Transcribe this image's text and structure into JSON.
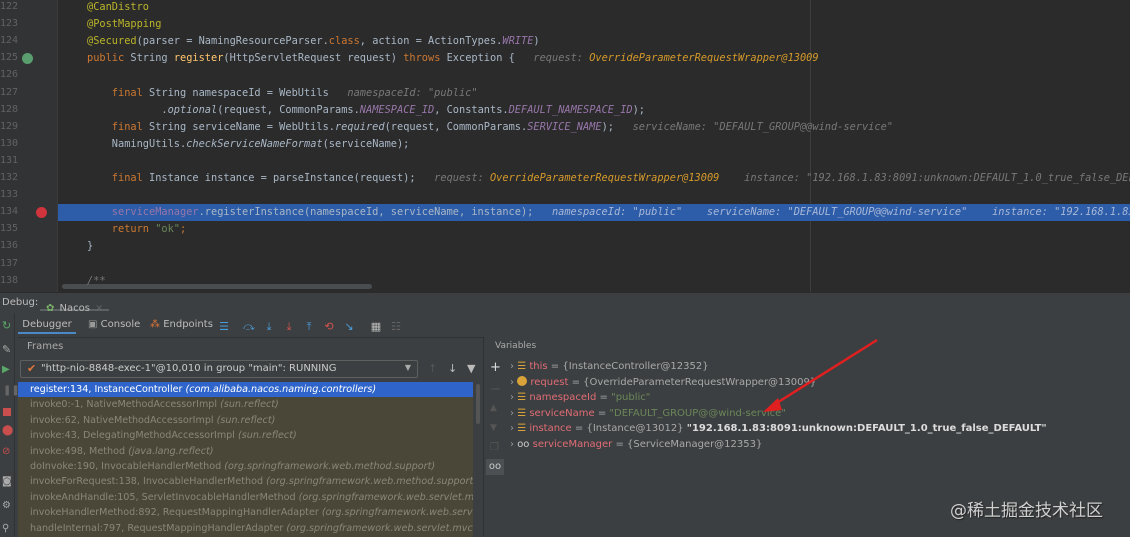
{
  "editor": {
    "line_numbers": [
      "122",
      "123",
      "124",
      "125",
      "126",
      "127",
      "128",
      "129",
      "130",
      "131",
      "132",
      "133",
      "134",
      "135",
      "136",
      "137",
      "138"
    ],
    "lines": [
      [
        {
          "t": "@CanDistro",
          "c": "ann"
        }
      ],
      [
        {
          "t": "@PostMapping",
          "c": "ann"
        }
      ],
      [
        {
          "t": "@Secured",
          "c": "ann"
        },
        {
          "t": "(parser = NamingResourceParser.",
          "c": "plain"
        },
        {
          "t": "class",
          "c": "kw"
        },
        {
          "t": ", action = ActionTypes.",
          "c": "plain"
        },
        {
          "t": "WRITE",
          "c": "const"
        },
        {
          "t": ")",
          "c": "plain"
        }
      ],
      [
        {
          "t": "public ",
          "c": "kw"
        },
        {
          "t": "String ",
          "c": "plain"
        },
        {
          "t": "register",
          "c": "fn"
        },
        {
          "t": "(HttpServletRequest request) ",
          "c": "plain"
        },
        {
          "t": "throws ",
          "c": "kw"
        },
        {
          "t": "Exception {   ",
          "c": "plain"
        },
        {
          "t": "request: ",
          "c": "hint"
        },
        {
          "t": "OverrideParameterRequestWrapper@13009",
          "c": "hintv"
        }
      ],
      [],
      [
        {
          "t": "    final ",
          "c": "kw"
        },
        {
          "t": "String namespaceId = WebUtils   ",
          "c": "plain"
        },
        {
          "t": "namespaceId: \"public\"",
          "c": "hint"
        }
      ],
      [
        {
          "t": "            .",
          "c": "plain"
        },
        {
          "t": "optional",
          "c": "it"
        },
        {
          "t": "(request, CommonParams.",
          "c": "plain"
        },
        {
          "t": "NAMESPACE_ID",
          "c": "const"
        },
        {
          "t": ", Constants.",
          "c": "plain"
        },
        {
          "t": "DEFAULT_NAMESPACE_ID",
          "c": "const"
        },
        {
          "t": ");",
          "c": "plain"
        }
      ],
      [
        {
          "t": "    final ",
          "c": "kw"
        },
        {
          "t": "String serviceName = WebUtils.",
          "c": "plain"
        },
        {
          "t": "required",
          "c": "it"
        },
        {
          "t": "(request, CommonParams.",
          "c": "plain"
        },
        {
          "t": "SERVICE_NAME",
          "c": "const"
        },
        {
          "t": ");   ",
          "c": "plain"
        },
        {
          "t": "serviceName: \"DEFAULT_GROUP@@wind-service\"",
          "c": "hint"
        }
      ],
      [
        {
          "t": "    NamingUtils.",
          "c": "plain"
        },
        {
          "t": "checkServiceNameFormat",
          "c": "it"
        },
        {
          "t": "(serviceName);",
          "c": "plain"
        }
      ],
      [],
      [
        {
          "t": "    final ",
          "c": "kw"
        },
        {
          "t": "Instance instance = parseInstance(request);   ",
          "c": "plain"
        },
        {
          "t": "request: ",
          "c": "hint"
        },
        {
          "t": "OverrideParameterRequestWrapper@13009",
          "c": "hintv"
        },
        {
          "t": "    instance: \"192.168.1.83:8091:unknown:DEFAULT_1.0_true_false_DEFAULT\"",
          "c": "hint"
        }
      ],
      [],
      [
        {
          "t": "    serviceManager",
          "c": "field"
        },
        {
          "t": ".registerInstance(namespaceId, serviceName, instance);   ",
          "c": "plain"
        },
        {
          "t": "namespaceId: \"public\"    serviceName: \"DEFAULT_GROUP@@wind-service\"    instance: \"192.168.1.83:8091:unknown:DEFAULT_1.0_true_false_DEFAULT\"",
          "c": "hint"
        }
      ],
      [
        {
          "t": "    return ",
          "c": "kw"
        },
        {
          "t": "\"ok\"",
          "c": "str"
        },
        {
          "t": ";",
          "c": "kw"
        }
      ],
      [
        {
          "t": "}",
          "c": "plain"
        }
      ],
      [],
      [
        {
          "t": "/**",
          "c": "hint"
        }
      ]
    ],
    "current_line": "134"
  },
  "debug": {
    "label": "Debug:",
    "session_tab": "Nacos",
    "tabs": [
      "Debugger",
      "Console",
      "Endpoints"
    ],
    "frames_title": "Frames",
    "thread": "\"http-nio-8848-exec-1\"@10,010 in group \"main\": RUNNING",
    "frames": [
      {
        "m": "register:134, InstanceController",
        "p": "(com.alibaba.nacos.naming.controllers)"
      },
      {
        "m": "invoke0:-1, NativeMethodAccessorImpl",
        "p": "(sun.reflect)"
      },
      {
        "m": "invoke:62, NativeMethodAccessorImpl",
        "p": "(sun.reflect)"
      },
      {
        "m": "invoke:43, DelegatingMethodAccessorImpl",
        "p": "(sun.reflect)"
      },
      {
        "m": "invoke:498, Method",
        "p": "(java.lang.reflect)"
      },
      {
        "m": "doInvoke:190, InvocableHandlerMethod",
        "p": "(org.springframework.web.method.support)"
      },
      {
        "m": "invokeForRequest:138, InvocableHandlerMethod",
        "p": "(org.springframework.web.method.support)"
      },
      {
        "m": "invokeAndHandle:105, ServletInvocableHandlerMethod",
        "p": "(org.springframework.web.servlet.mvc.method.annotation)"
      },
      {
        "m": "invokeHandlerMethod:892, RequestMappingHandlerAdapter",
        "p": "(org.springframework.web.servlet.mvc.method.annotation)"
      },
      {
        "m": "handleInternal:797, RequestMappingHandlerAdapter",
        "p": "(org.springframework.web.servlet.mvc.method.annotation)"
      }
    ],
    "variables_title": "Variables",
    "variables": [
      {
        "name": "this",
        "value": "{InstanceController@12352}",
        "extra": "",
        "icon": "field"
      },
      {
        "name": "request",
        "value": "{OverrideParameterRequestWrapper@13009}",
        "extra": "",
        "icon": "param"
      },
      {
        "name": "namespaceId",
        "value": "\"public\"",
        "extra": "",
        "icon": "field"
      },
      {
        "name": "serviceName",
        "value": "\"DEFAULT_GROUP@@wind-service\"",
        "extra": "",
        "icon": "field"
      },
      {
        "name": "instance",
        "value": "{Instance@13012}",
        "extra": "\"192.168.1.83:8091:unknown:DEFAULT_1.0_true_false_DEFAULT\"",
        "icon": "field"
      },
      {
        "name": "serviceManager",
        "value": "{ServiceManager@12353}",
        "extra": "",
        "icon": "watch"
      }
    ]
  },
  "watermark": "@稀土掘金技术社区",
  "colors": {
    "selection": "#2f65ca",
    "arrow": "#e02020",
    "keyword": "#cc7832"
  }
}
